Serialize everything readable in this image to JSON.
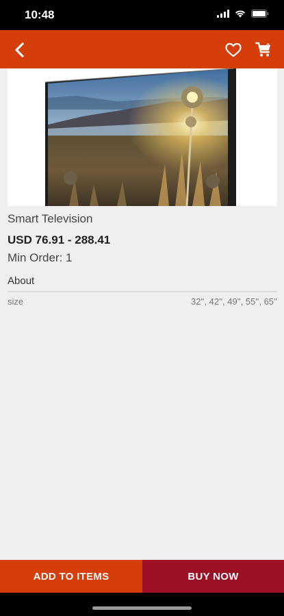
{
  "status_bar": {
    "time": "10:48",
    "icons": [
      "signal-icon",
      "wifi-icon",
      "battery-icon"
    ]
  },
  "app_bar": {
    "background": "#d53d0b",
    "back_icon": "chevron-left-icon",
    "favorite_icon": "heart-icon",
    "cart_icon": "cart-icon",
    "cart_count": "0"
  },
  "product": {
    "name": "Smart Television",
    "price": "USD 76.91 - 288.41",
    "min_order": "Min Order: 1",
    "about_label": "About",
    "attributes": [
      {
        "name": "size",
        "value": "32'', 42'', 49'', 55'', 65''"
      }
    ]
  },
  "actions": {
    "add_label": "ADD TO ITEMS",
    "buy_label": "BUY NOW",
    "add_color": "#d53d0b",
    "buy_color": "#9d0f25"
  }
}
